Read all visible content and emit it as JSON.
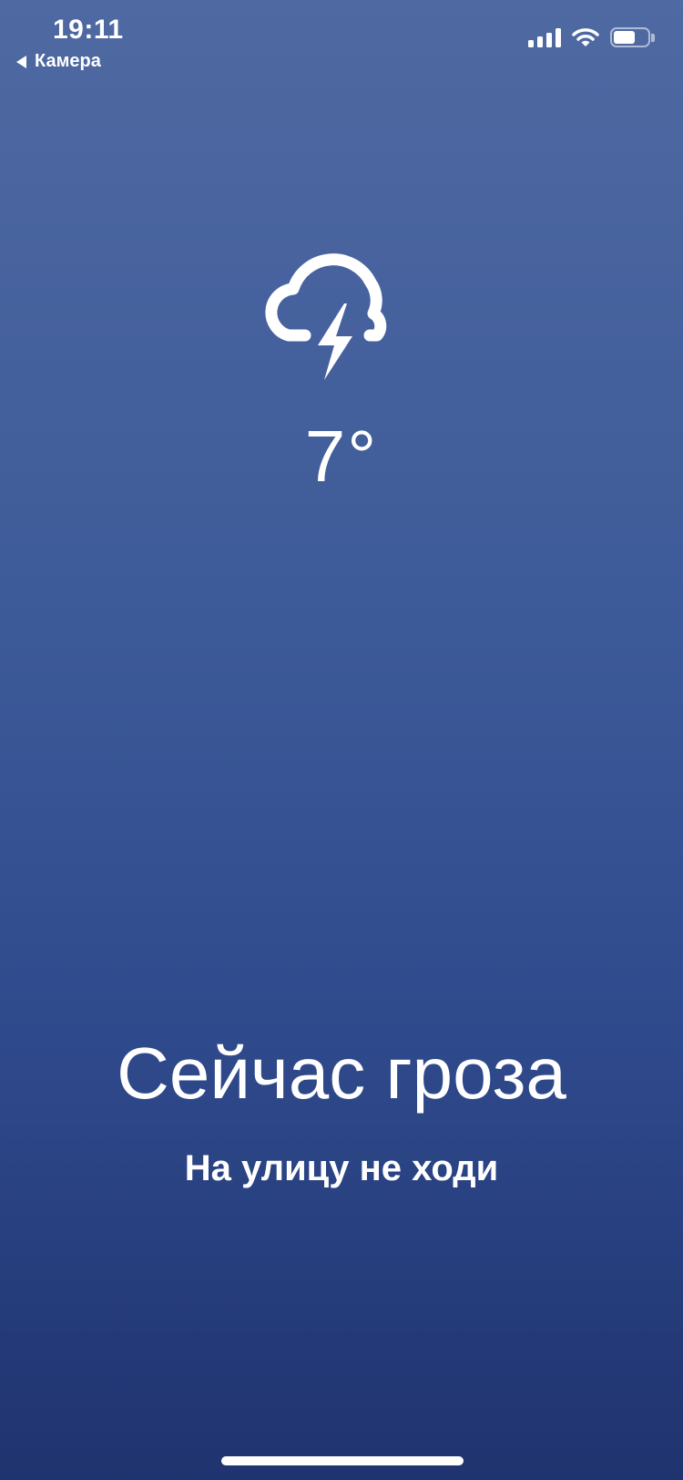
{
  "status_bar": {
    "time": "19:11",
    "back_label": "Камера",
    "battery_level": 0.65,
    "signal_bars": 4,
    "icons": [
      "signal-icon",
      "wifi-icon",
      "battery-icon"
    ]
  },
  "weather": {
    "icon": "cloud-lightning-icon",
    "temperature": "7°",
    "headline": "Сейчас гроза",
    "advice": "На улицу не ходи"
  },
  "colors": {
    "background_top": "#4f69a2",
    "background_bottom": "#1f336f",
    "foreground": "#ffffff"
  }
}
